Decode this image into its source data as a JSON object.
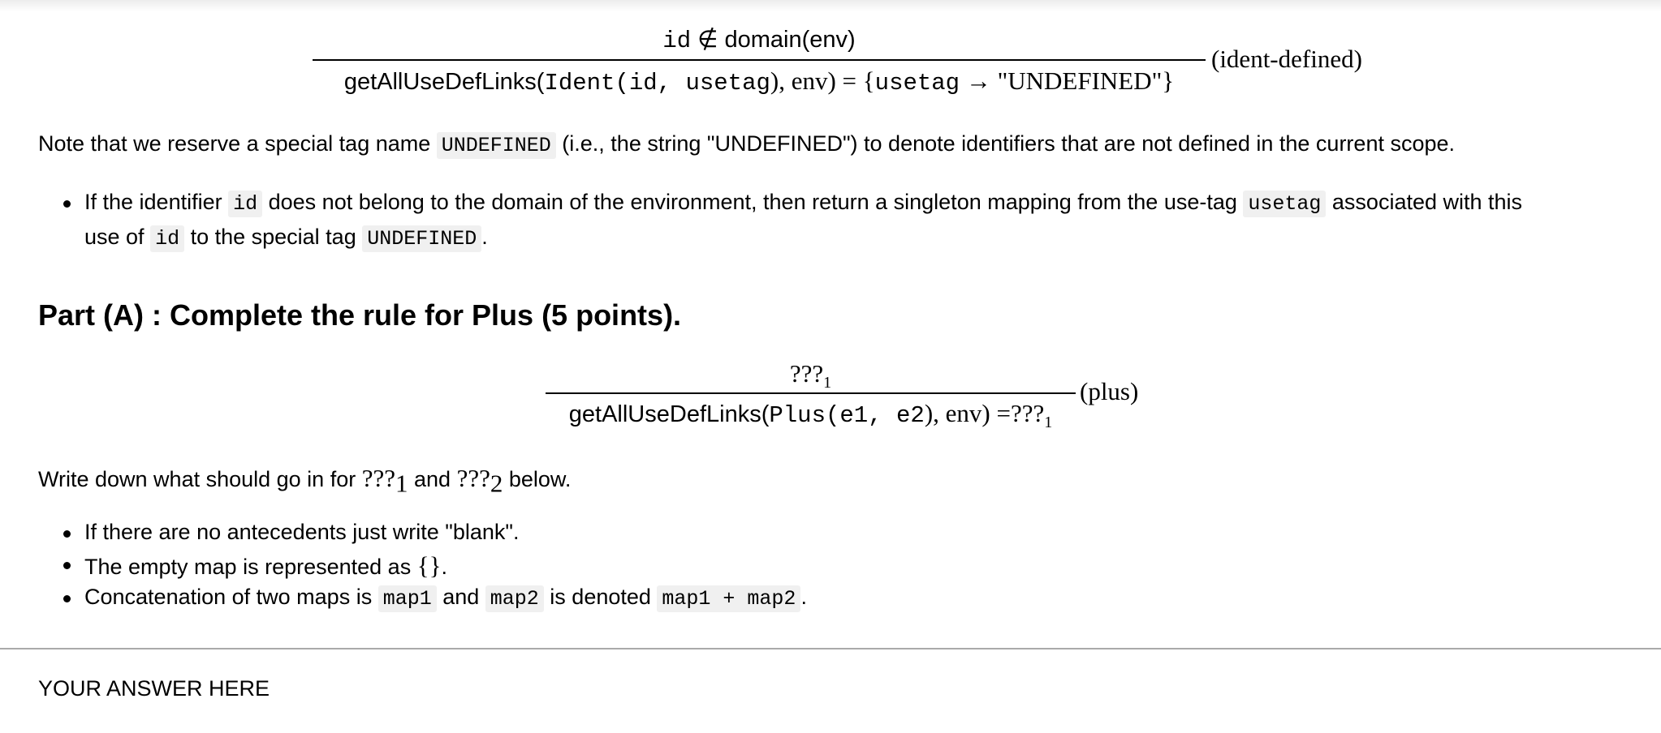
{
  "rule_ident": {
    "premise_id": "id",
    "premise_rest": " ∉ domain(env)",
    "conclusion_fn": "getAllUseDefLinks(",
    "conclusion_ident": "Ident(id,  usetag",
    "conclusion_mid": "), env) = {",
    "conclusion_usetag": "usetag",
    "conclusion_tail": " → \"UNDEFINED\"}",
    "label": "(ident-defined)"
  },
  "note": {
    "before": "Note that we reserve a special tag name ",
    "code": "UNDEFINED",
    "after": " (i.e., the string \"UNDEFINED\") to denote identifiers that are not defined in the current scope."
  },
  "bullet1": {
    "t1": "If the identifier ",
    "c1": "id",
    "t2": " does not belong to the domain of the environment, then return a singleton mapping from the use-tag ",
    "c2": "usetag",
    "t3": " associated with this",
    "t4": "use of ",
    "c3": "id",
    "t5": " to the special tag ",
    "c4": "UNDEFINED",
    "t6": "."
  },
  "heading": "Part (A) : Complete the rule for Plus (5 points).",
  "rule_plus": {
    "premise": "???",
    "premise_sub": "1",
    "conclusion_fn": "getAllUseDefLinks(",
    "conclusion_plus": "Plus(e1,  e2",
    "conclusion_mid": "), env) =???",
    "conclusion_sub": "1",
    "label": "(plus)"
  },
  "write_down": {
    "t1": "Write down what should go in for ",
    "q1": "???",
    "s1": "1",
    "t2": " and ",
    "q2": "???",
    "s2": "2",
    "t3": " below."
  },
  "bullets": {
    "b1": "If there are no antecedents just write \"blank\".",
    "b2_text": "The empty map is represented as ",
    "b2_math": "{}",
    "b2_end": ".",
    "b3_t1": "Concatenation of two maps is ",
    "b3_c1": "map1",
    "b3_t2": " and ",
    "b3_c2": "map2",
    "b3_t3": " is denoted ",
    "b3_c3": "map1 + map2",
    "b3_t4": "."
  },
  "answer": "YOUR ANSWER HERE"
}
